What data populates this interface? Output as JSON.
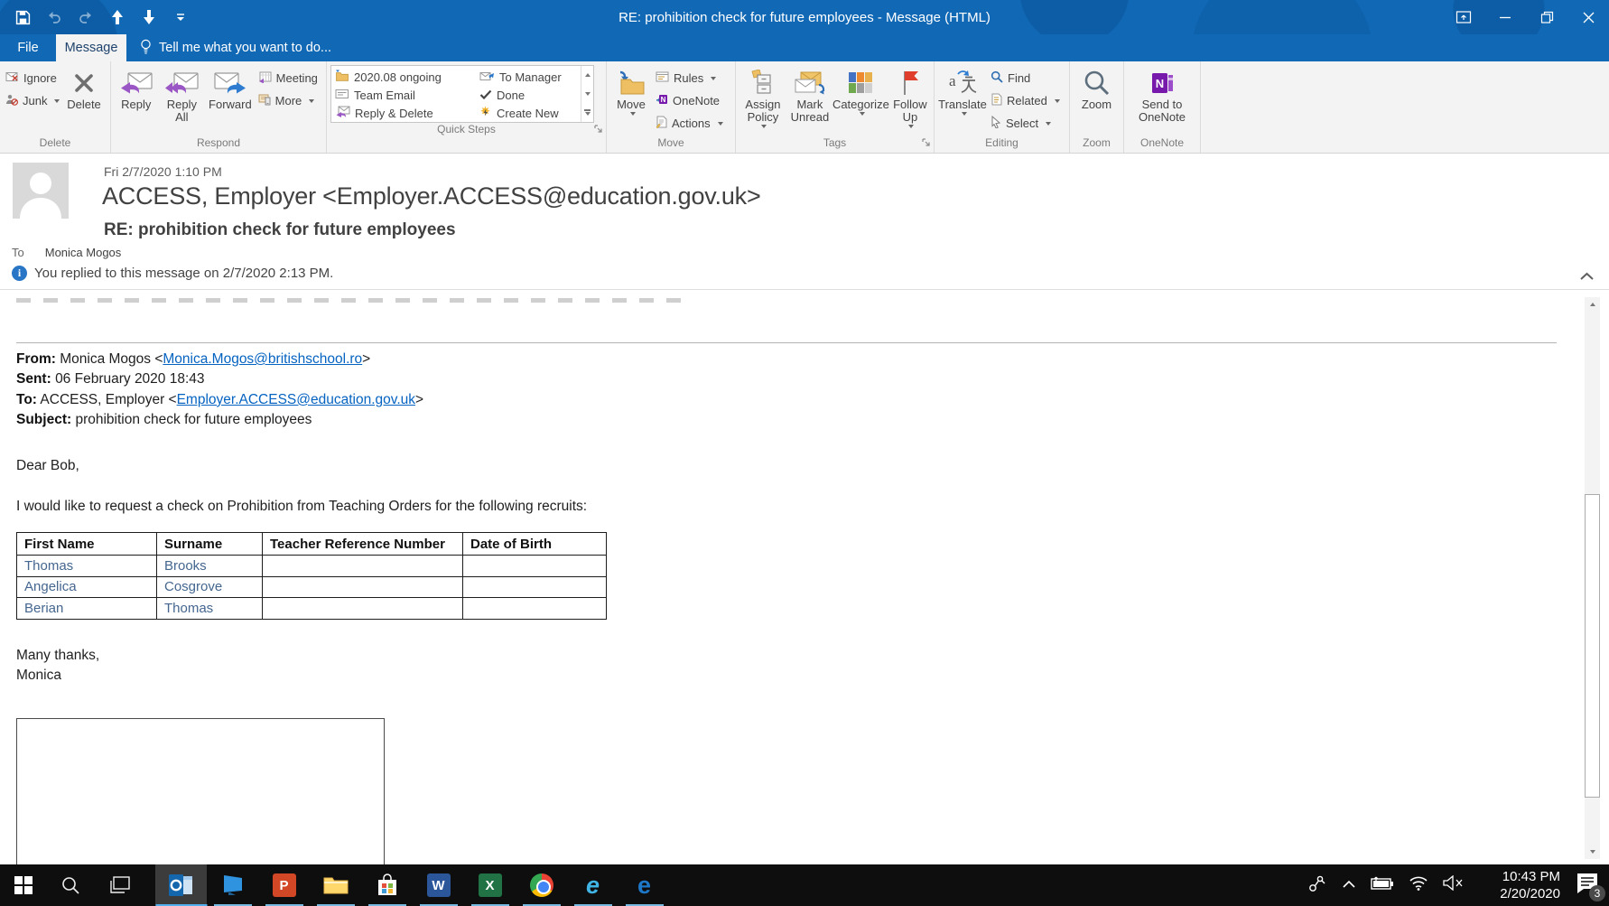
{
  "titlebar": {
    "title": "RE: prohibition check for future employees - Message (HTML)"
  },
  "tabs": {
    "file": "File",
    "message": "Message",
    "tell_me": "Tell me what you want to do..."
  },
  "ribbon": {
    "delete_group": {
      "ignore": "Ignore",
      "junk": "Junk",
      "delete": "Delete",
      "label": "Delete"
    },
    "respond_group": {
      "reply": "Reply",
      "reply_all": "Reply All",
      "forward": "Forward",
      "meeting": "Meeting",
      "more": "More",
      "label": "Respond"
    },
    "quick_steps": {
      "items": [
        {
          "label": "2020.08 ongoing"
        },
        {
          "label": "Team Email"
        },
        {
          "label": "Reply & Delete"
        },
        {
          "label": "To Manager"
        },
        {
          "label": "Done"
        },
        {
          "label": "Create New"
        }
      ],
      "label": "Quick Steps"
    },
    "move_group": {
      "move": "Move",
      "rules": "Rules",
      "onenote": "OneNote",
      "actions": "Actions",
      "label": "Move"
    },
    "tags_group": {
      "assign_policy": "Assign Policy",
      "mark_unread": "Mark Unread",
      "categorize": "Categorize",
      "follow_up": "Follow Up",
      "label": "Tags"
    },
    "editing_group": {
      "translate": "Translate",
      "find": "Find",
      "related": "Related",
      "select": "Select",
      "label": "Editing"
    },
    "zoom_group": {
      "zoom": "Zoom",
      "label": "Zoom"
    },
    "onenote_group": {
      "send": "Send to OneNote",
      "label": "OneNote"
    }
  },
  "message": {
    "date": "Fri 2/7/2020 1:10 PM",
    "sender": "ACCESS, Employer <Employer.ACCESS@education.gov.uk>",
    "subject": "RE: prohibition check for future employees",
    "to_label": "To",
    "to_value": "Monica Mogos",
    "infobar": "You replied to this message on 2/7/2020 2:13 PM."
  },
  "body": {
    "from_label": "From:",
    "from_prefix": "Monica Mogos <",
    "from_link": "Monica.Mogos@britishschool.ro",
    "from_suffix": ">",
    "sent_label": "Sent:",
    "sent_value": "06 February 2020 18:43",
    "to_label": "To:",
    "to_prefix": "ACCESS, Employer <",
    "to_link": "Employer.ACCESS@education.gov.uk",
    "to_suffix": ">",
    "subject_label": "Subject:",
    "subject_value": "prohibition check for future employees",
    "greeting": "Dear Bob,",
    "request": "I would like to request a check on Prohibition from Teaching Orders for the following recruits:",
    "table": {
      "headers": [
        "First Name",
        "Surname",
        "Teacher Reference Number",
        "Date of Birth"
      ],
      "rows": [
        [
          "Thomas",
          "Brooks",
          "",
          ""
        ],
        [
          "Angelica",
          "Cosgrove",
          "",
          ""
        ],
        [
          "Berian",
          "Thomas",
          "",
          ""
        ]
      ]
    },
    "closing_1": "Many thanks,",
    "closing_2": "Monica"
  },
  "taskbar": {
    "time": "10:43 PM",
    "date": "2/20/2020",
    "notification_count": "3"
  },
  "colors": {
    "titlebar_blue": "#1168b5",
    "link_blue": "#0563c1",
    "table_text_blue": "#44668f",
    "flag_red": "#e03e2d",
    "onenote_purple": "#7719aa",
    "taskbar_underline": "#76b9e0"
  }
}
